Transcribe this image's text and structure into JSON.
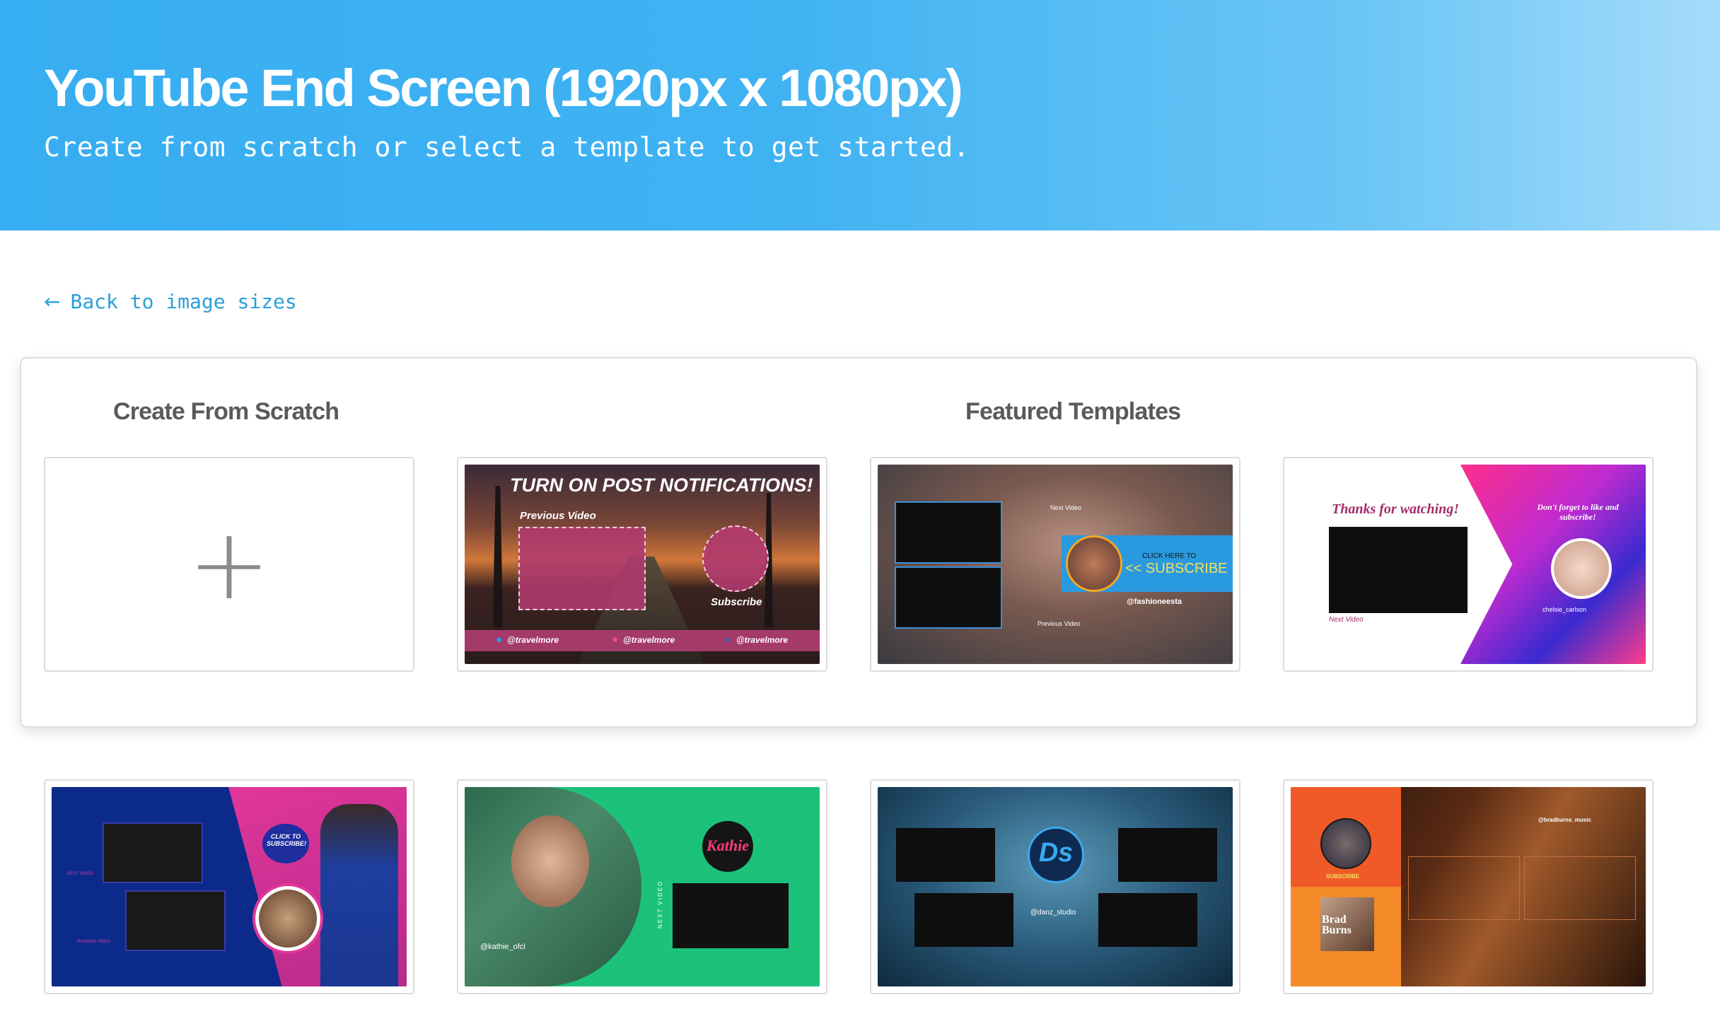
{
  "header": {
    "title": "YouTube End Screen (1920px x 1080px)",
    "subtitle": "Create from scratch or select a template to get started."
  },
  "back_link": {
    "label": "Back to image sizes"
  },
  "sections": {
    "scratch_heading": "Create From Scratch",
    "featured_heading": "Featured Templates"
  },
  "templates": {
    "t1": {
      "headline": "TURN ON POST NOTIFICATIONS!",
      "previous": "Previous Video",
      "subscribe": "Subscribe",
      "handles": [
        "@travelmore",
        "@travelmore",
        "@travelmore"
      ]
    },
    "t2": {
      "next": "Next Video",
      "cta_small": "CLICK HERE TO",
      "cta": "<< SUBSCRIBE",
      "handle": "@fashioneesta",
      "previous": "Previous Video"
    },
    "t3": {
      "thanks": "Thanks for watching!",
      "reminder": "Don't forget to like and subscribe!",
      "handle": "chelsie_carlson",
      "next": "Next Video"
    },
    "t4": {
      "bubble": "CLICK TO SUBSCRIBE!",
      "next": "NEXT VIDEO",
      "random": "RANDOM VIDEO"
    },
    "t5": {
      "name": "Kathie",
      "handle": "@kathie_ofcl",
      "next": "NEXT VIDEO"
    },
    "t6": {
      "logo": "Ds",
      "handle": "@danz_studio"
    },
    "t7": {
      "handle": "@bradburns_music",
      "subscribe": "SUBSCRIBE",
      "name": "Brad Burns"
    }
  },
  "colors": {
    "hero_start": "#37aef1",
    "hero_end": "#a6dcfb",
    "link": "#2b9fd9",
    "heading": "#5a5a5a"
  }
}
